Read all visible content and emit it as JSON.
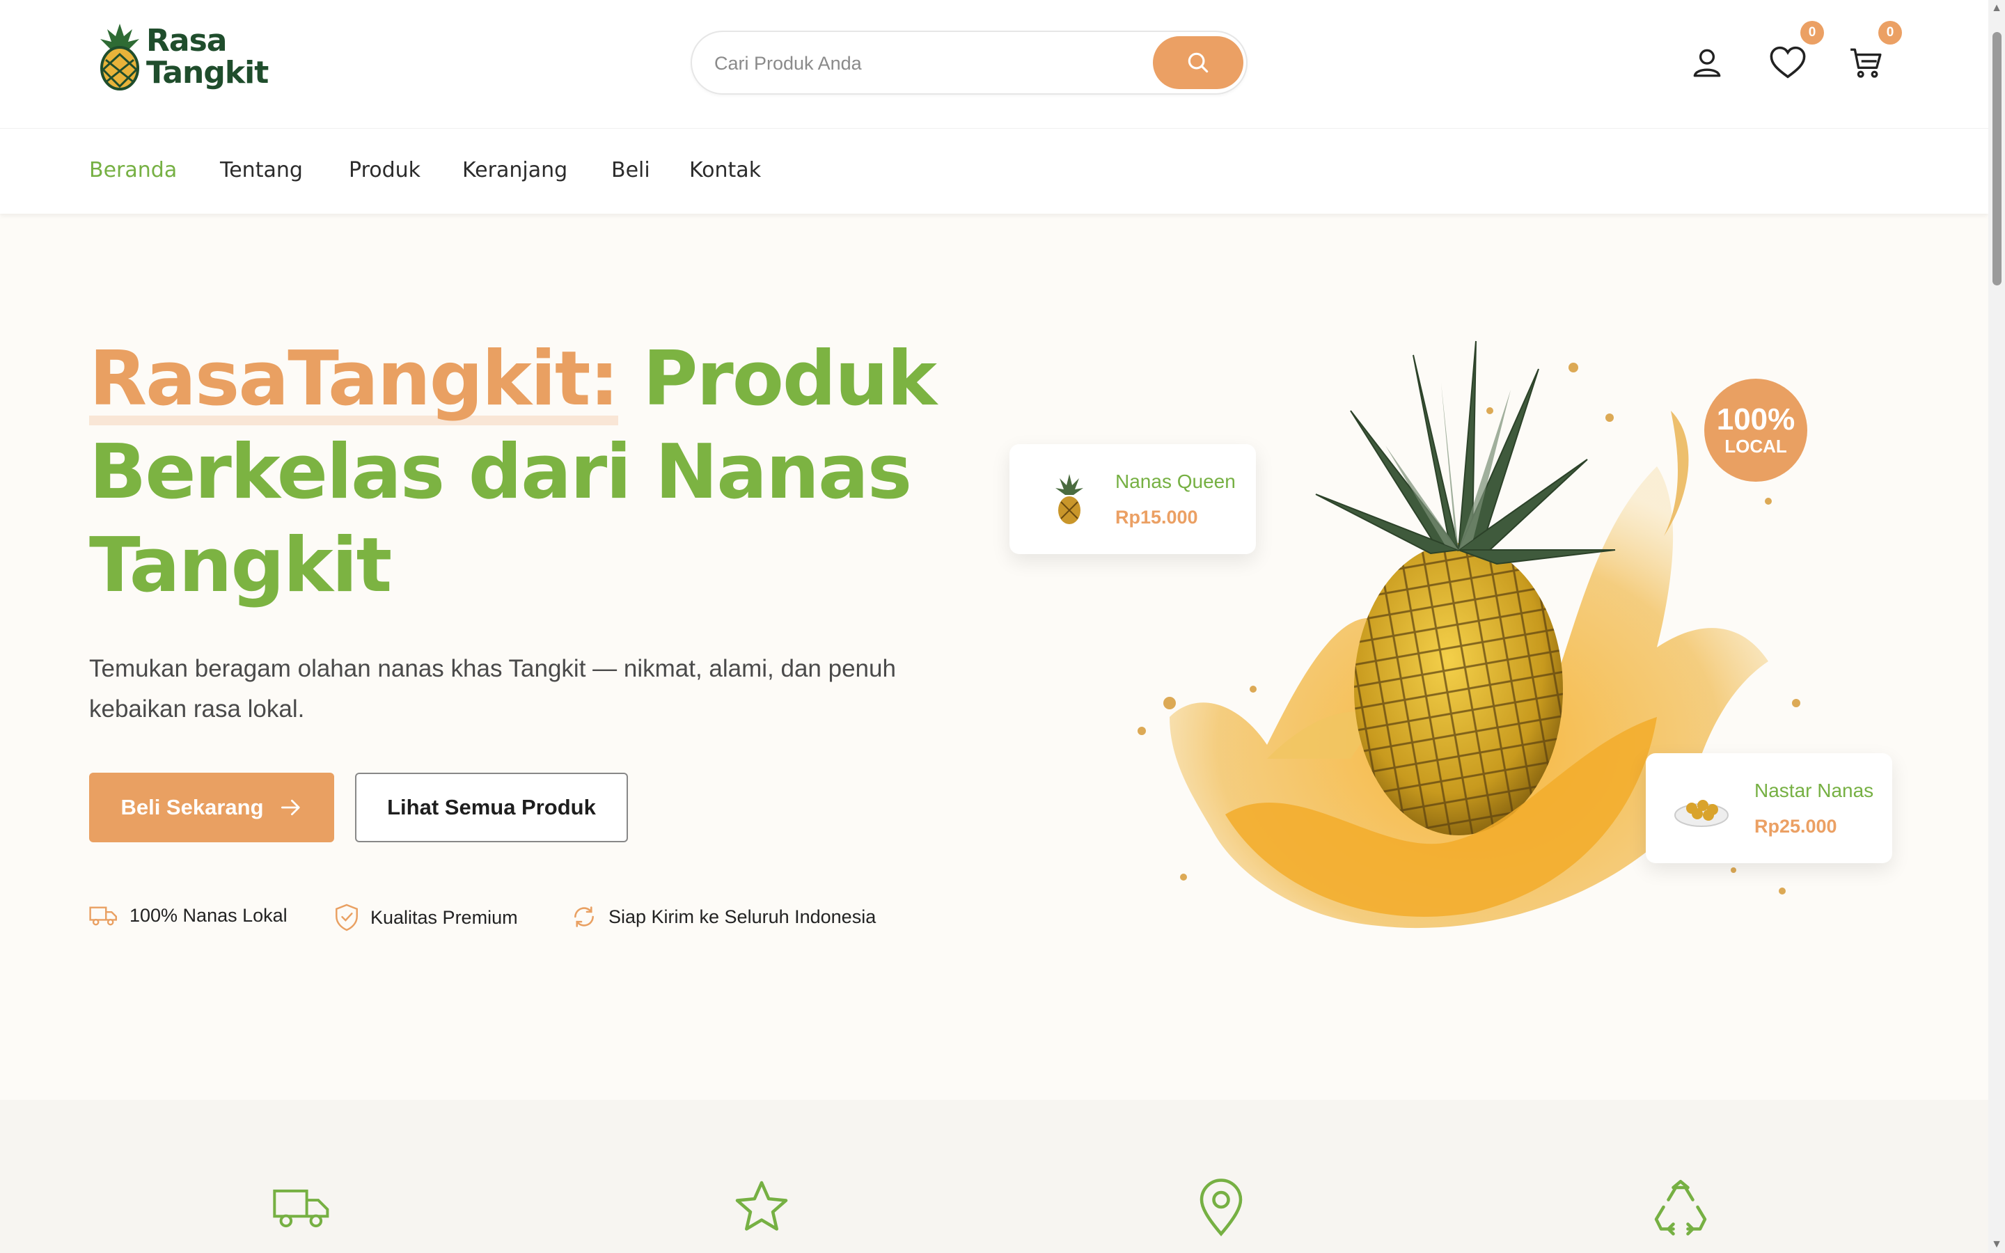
{
  "header": {
    "logo_line1": "Rasa",
    "logo_line2": "Tangkit",
    "search_placeholder": "Cari Produk Anda",
    "wishlist_count": "0",
    "cart_count": "0"
  },
  "nav": {
    "items": [
      {
        "label": "Beranda",
        "active": true
      },
      {
        "label": "Tentang"
      },
      {
        "label": "Produk"
      },
      {
        "label": "Keranjang"
      },
      {
        "label": "Beli"
      },
      {
        "label": "Kontak"
      }
    ]
  },
  "hero": {
    "title_brand": "RasaTangkit:",
    "title_rest": " Produk Berkelas dari Nanas Tangkit",
    "subtitle": "Temukan beragam olahan nanas khas Tangkit — nikmat, alami, dan penuh kebaikan rasa lokal.",
    "primary_button": "Beli Sekarang",
    "secondary_button": "Lihat Semua Produk",
    "features": [
      {
        "icon": "truck-icon",
        "label": "100% Nanas Lokal"
      },
      {
        "icon": "shield-icon",
        "label": "Kualitas Premium"
      },
      {
        "icon": "refresh-icon",
        "label": "Siap Kirim ke Seluruh Indonesia"
      }
    ],
    "badge_big": "100%",
    "badge_small": "LOCAL",
    "cards": [
      {
        "name": "Nanas Queen",
        "price": "Rp15.000"
      },
      {
        "name": "Nastar Nanas",
        "price": "Rp25.000"
      }
    ]
  },
  "benefits": {
    "icons": [
      "truck-icon",
      "star-icon",
      "map-pin-icon",
      "recycle-icon"
    ]
  },
  "colors": {
    "accent_green": "#7cb342",
    "accent_orange": "#e9a062",
    "logo_green": "#1f4d2c"
  }
}
